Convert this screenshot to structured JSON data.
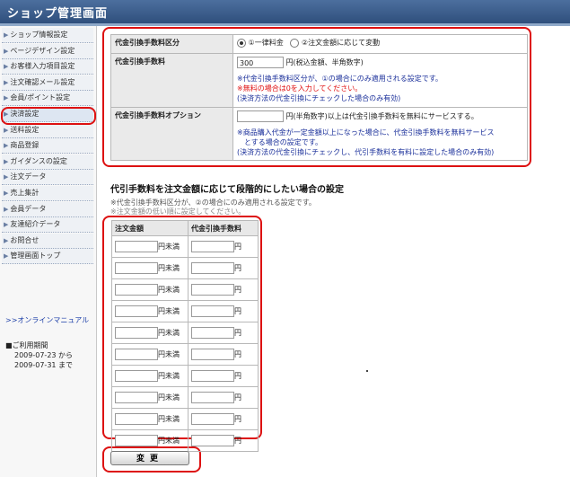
{
  "header": {
    "title": "ショップ管理画面"
  },
  "sidebar": {
    "items": [
      {
        "label": "ショップ情報設定"
      },
      {
        "label": "ページデザイン設定"
      },
      {
        "label": "お客様入力項目設定"
      },
      {
        "label": "注文確認メール設定"
      },
      {
        "label": "会員/ポイント設定"
      },
      {
        "label": "決済設定",
        "active": true
      },
      {
        "label": "送料設定"
      },
      {
        "label": "商品登録"
      },
      {
        "label": "ガイダンスの設定"
      },
      {
        "label": "注文データ"
      },
      {
        "label": "売上集計"
      },
      {
        "label": "会員データ"
      },
      {
        "label": "友達紹介データ"
      },
      {
        "label": "お問合せ"
      },
      {
        "label": "管理画面トップ"
      }
    ],
    "manual_link": ">>オンラインマニュアル",
    "period_label": "■ご利用期間",
    "period_from": "2009-07-23",
    "period_from_suffix": "から",
    "period_to": "2009-07-31",
    "period_to_suffix": "まで"
  },
  "settings": {
    "type_label": "代金引換手数料区分",
    "option1": "①一律料金",
    "option2": "②注文金額に応じて変動",
    "fee_label": "代金引換手数料",
    "fee_value": "300",
    "fee_unit": "円(税込金額、半角数字)",
    "fee_note1": "※代金引換手数料区分が、①の場合にのみ適用される設定です。",
    "fee_note2": "※無料の場合は0を入力してください。",
    "fee_note3": "(決済方法の代金引換にチェックした場合のみ有効)",
    "option_label": "代金引換手数料オプション",
    "option_unit": "円(半角数字)以上は代金引換手数料を無料にサービスする。",
    "option_note1": "※商品購入代金が一定金額以上になった場合に、代金引換手数料を無料サービス",
    "option_note1b": "とする場合の設定です。",
    "option_note2": "(決済方法の代金引換にチェックし、代引手数料を有料に設定した場合のみ有効)"
  },
  "tiers": {
    "section_title": "代引手数料を注文金額に応じて段階的にしたい場合の設定",
    "note1": "※代金引換手数料区分が、②の場合にのみ適用される設定です。",
    "note2": "※注文金額の低い順に設定してください。",
    "col_amount": "注文金額",
    "col_fee": "代金引換手数料",
    "amount_suffix": "円未満",
    "fee_suffix": "円",
    "rows": [
      {
        "amount": "",
        "fee": ""
      },
      {
        "amount": "",
        "fee": ""
      },
      {
        "amount": "",
        "fee": ""
      },
      {
        "amount": "",
        "fee": ""
      },
      {
        "amount": "",
        "fee": ""
      },
      {
        "amount": "",
        "fee": ""
      },
      {
        "amount": "",
        "fee": ""
      },
      {
        "amount": "",
        "fee": ""
      },
      {
        "amount": "",
        "fee": ""
      },
      {
        "amount": "",
        "fee": ""
      }
    ]
  },
  "submit_label": "変更",
  "colors": {
    "header": "#3a5a88",
    "highlight": "#dd1111",
    "note": "#1a2f9a",
    "warning": "#e01010"
  }
}
